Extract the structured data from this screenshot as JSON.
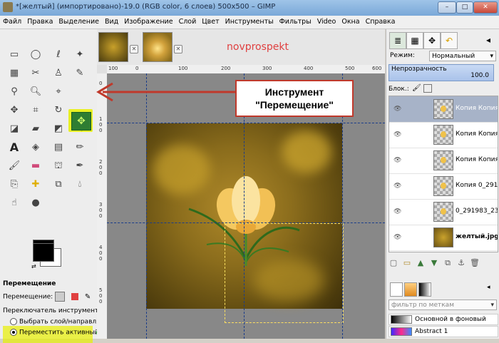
{
  "window": {
    "title": "*[желтый] (импортировано)-19.0 (RGB color, 6 слоев) 500x500 – GIMP"
  },
  "menu": [
    "Файл",
    "Правка",
    "Выделение",
    "Вид",
    "Изображение",
    "Слой",
    "Цвет",
    "Инструменты",
    "Фильтры",
    "Video",
    "Окна",
    "Справка"
  ],
  "watermark": "novprospekt",
  "callout": {
    "line1": "Инструмент",
    "line2": "\"Перемещение\""
  },
  "rulers": {
    "top": [
      "100",
      "0",
      "100",
      "200",
      "300",
      "400",
      "500",
      "600"
    ],
    "left": [
      "0",
      "1",
      "0",
      "0",
      "2",
      "0",
      "0",
      "3",
      "0",
      "0",
      "4",
      "0",
      "0",
      "5",
      "0",
      "0"
    ]
  },
  "tool_options": {
    "title": "Перемещение",
    "move_label": "Перемещение:",
    "switch_label": "Переключатель инструмента",
    "option1": "Выбрать слой/направля",
    "option2": "Переместить активный"
  },
  "dock": {
    "mode_label": "Режим:",
    "mode_value": "Нормальный",
    "opacity_label": "Непрозрачность",
    "opacity_value": "100.0",
    "lock_label": "Блок.:",
    "layers": [
      {
        "name": "Копия Копия К",
        "selected": true
      },
      {
        "name": "Копия Копия К",
        "selected": false
      },
      {
        "name": "Копия Копия 0",
        "selected": false
      },
      {
        "name": "Копия 0_291983",
        "selected": false
      },
      {
        "name": "0_291983_232e",
        "selected": false
      },
      {
        "name": "желтый.jpg",
        "selected": false
      }
    ],
    "tag_filter_placeholder": "фильтр по меткам",
    "gradients": [
      "Основной в фоновый (рез",
      "Abstract 1"
    ]
  },
  "colors": {
    "accent_highlight": "#e8f000",
    "callout_border": "#c0392b",
    "move_tool": "#2e7d32"
  }
}
